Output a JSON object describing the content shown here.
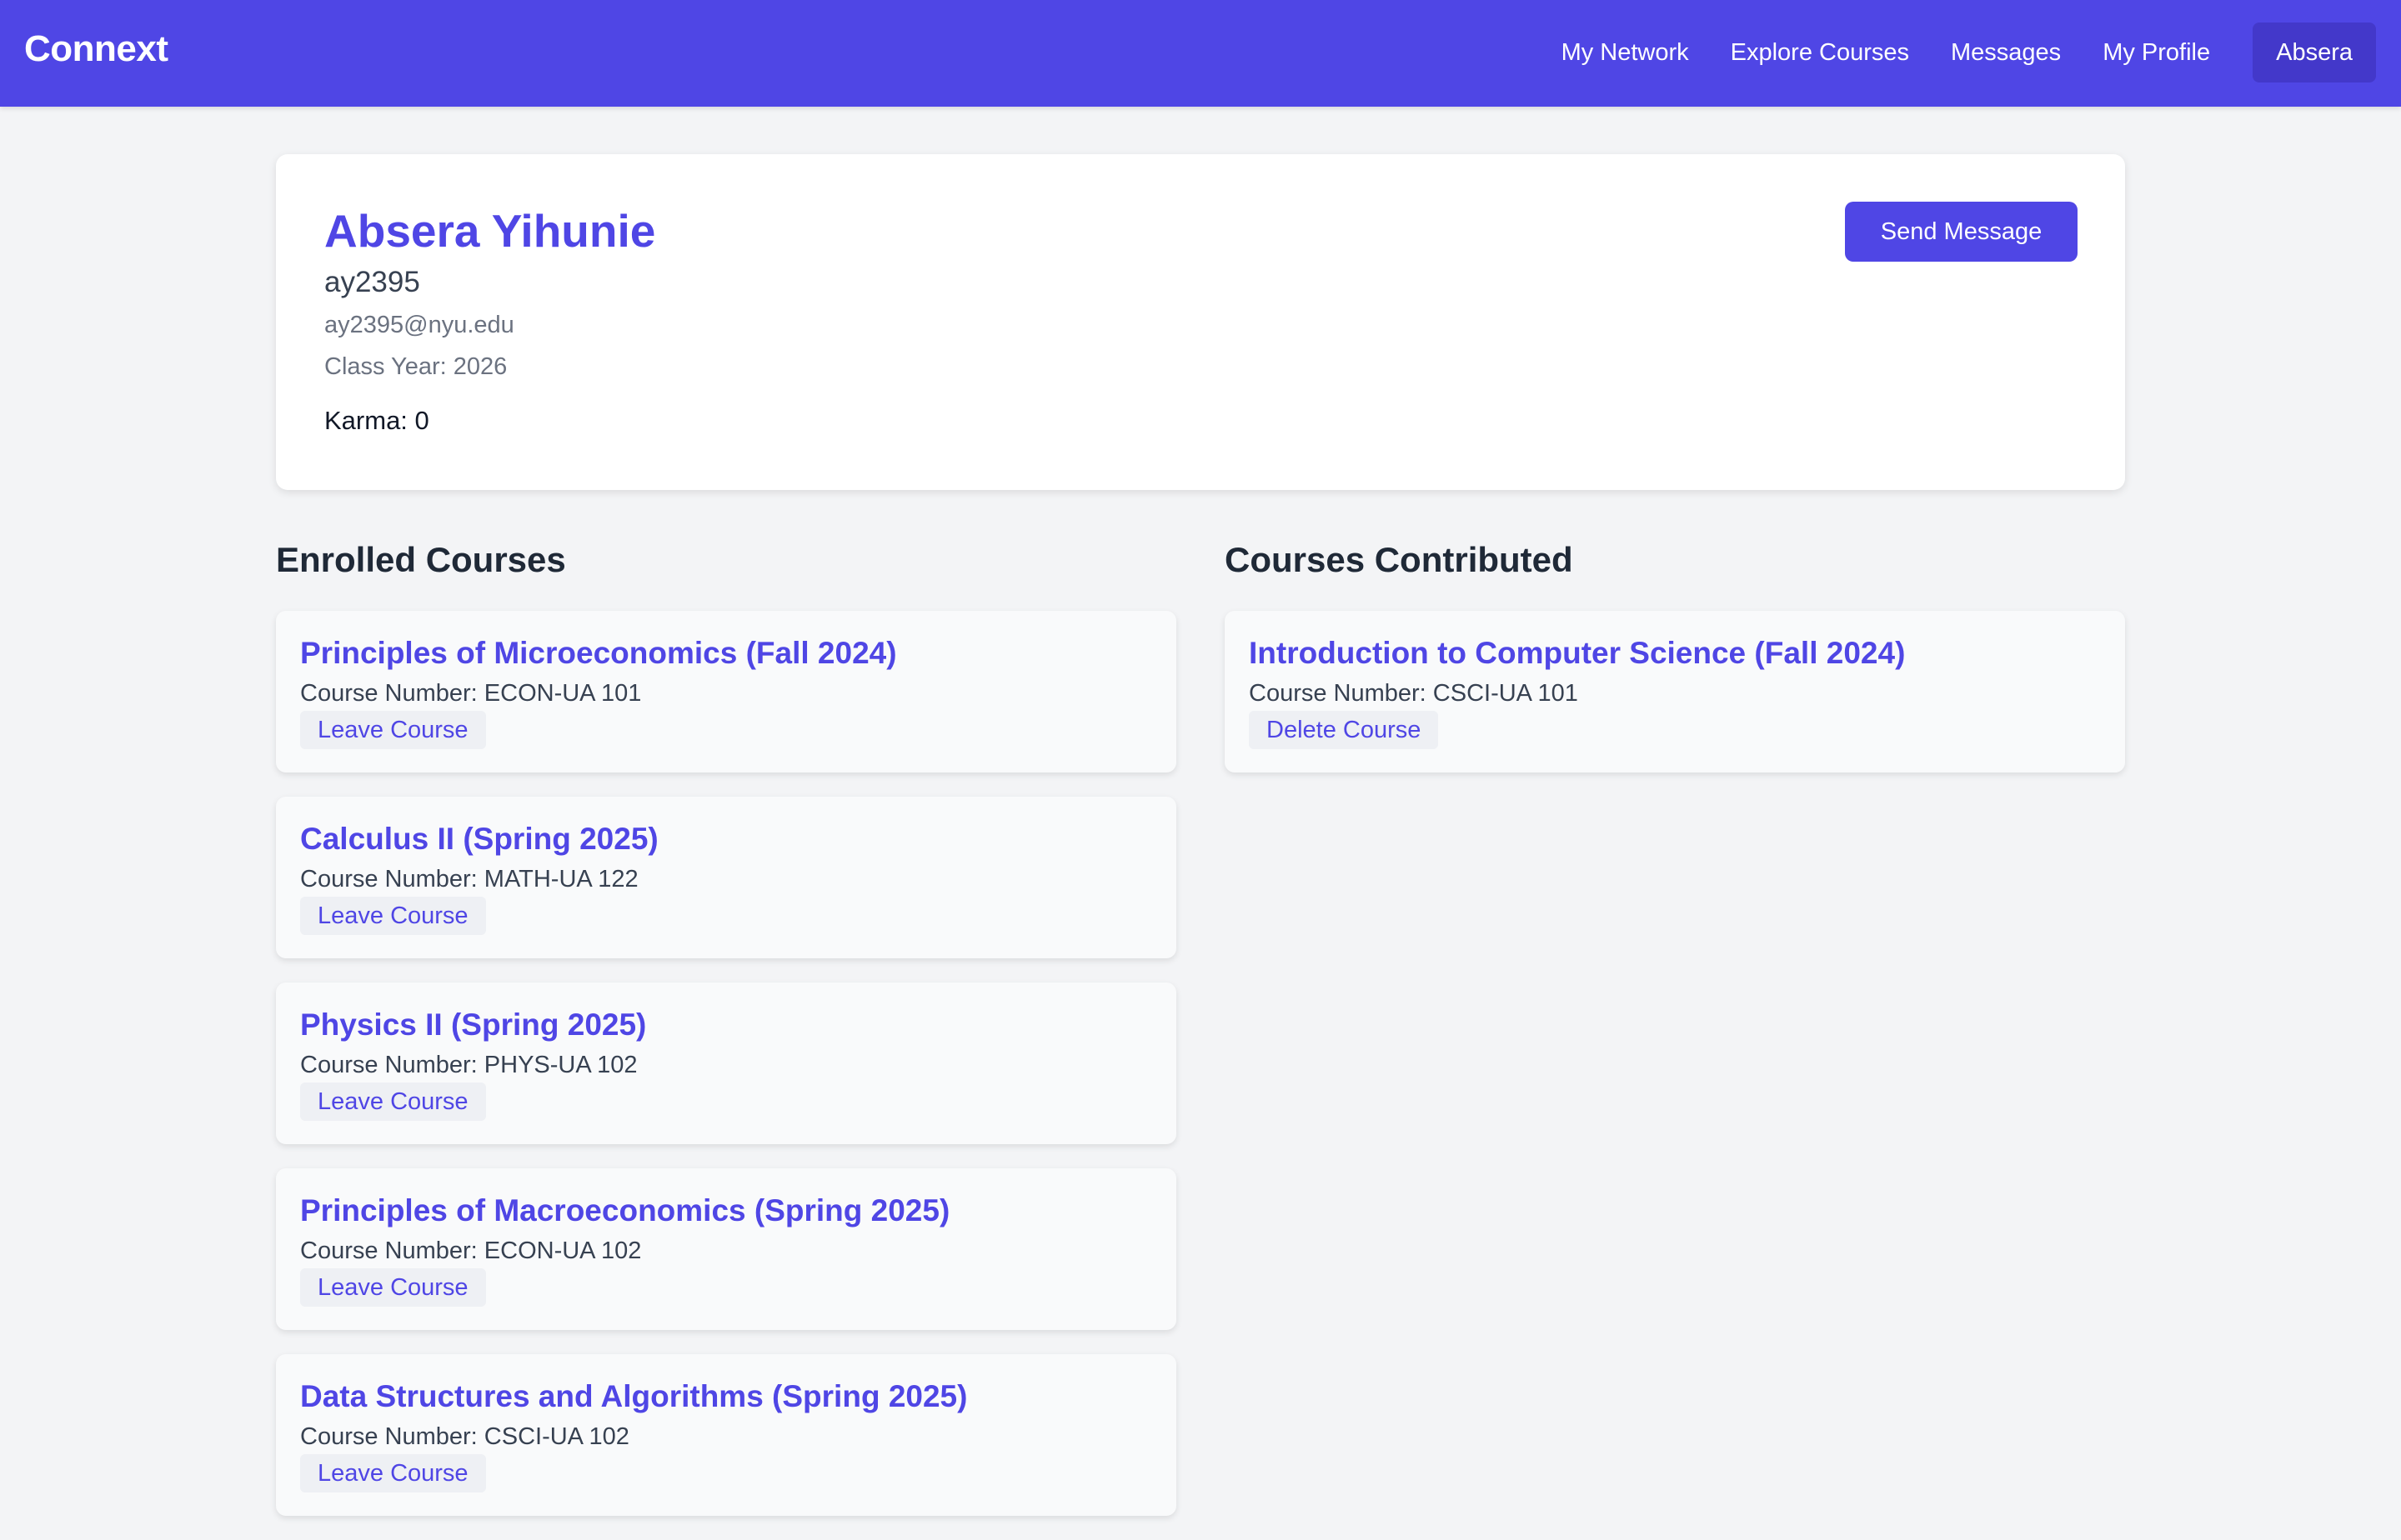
{
  "navbar": {
    "brand": "Connext",
    "links": [
      "My Network",
      "Explore Courses",
      "Messages",
      "My Profile"
    ],
    "user_button": "Absera",
    "color": "#4f46e5"
  },
  "profile": {
    "name": "Absera Yihunie",
    "netid": "ay2395",
    "email": "ay2395@nyu.edu",
    "class_year": "Class Year: 2026",
    "karma": "Karma: 0",
    "send_message_label": "Send Message"
  },
  "enrolled": {
    "heading": "Enrolled Courses",
    "courses": [
      {
        "title": "Principles of Microeconomics (Fall 2024)",
        "number": "Course Number: ECON-UA 101",
        "action": "Leave Course"
      },
      {
        "title": "Calculus II (Spring 2025)",
        "number": "Course Number: MATH-UA 122",
        "action": "Leave Course"
      },
      {
        "title": "Physics II (Spring 2025)",
        "number": "Course Number: PHYS-UA 102",
        "action": "Leave Course"
      },
      {
        "title": "Principles of Macroeconomics (Spring 2025)",
        "number": "Course Number: ECON-UA 102",
        "action": "Leave Course"
      },
      {
        "title": "Data Structures and Algorithms (Spring 2025)",
        "number": "Course Number: CSCI-UA 102",
        "action": "Leave Course"
      }
    ]
  },
  "contributed": {
    "heading": "Courses Contributed",
    "courses": [
      {
        "title": "Introduction to Computer Science (Fall 2024)",
        "number": "Course Number: CSCI-UA 101",
        "action": "Delete Course"
      }
    ]
  }
}
